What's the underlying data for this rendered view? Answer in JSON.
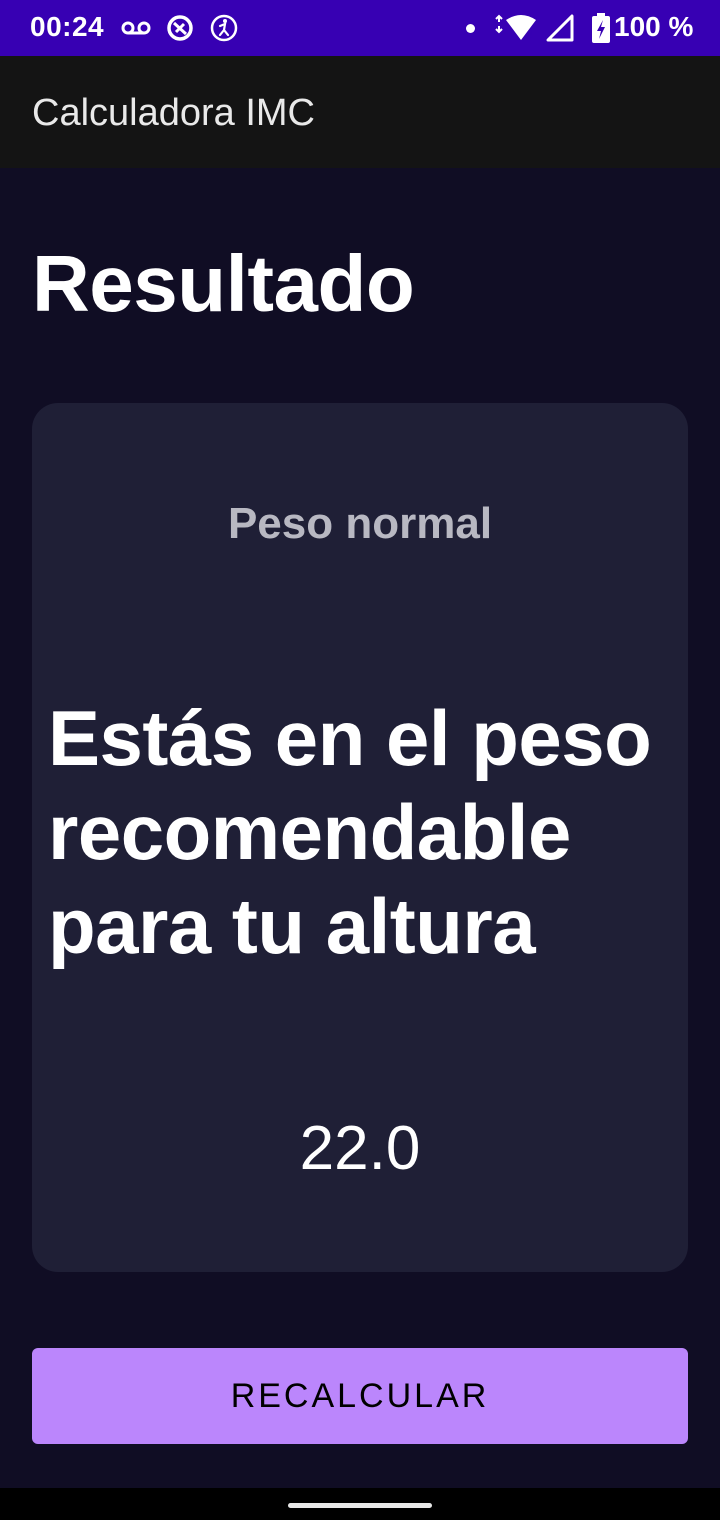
{
  "status_bar": {
    "time": "00:24",
    "battery_percent": "100 %",
    "icons": [
      "voicemail-icon",
      "data-saver-icon",
      "accessibility-icon",
      "notification-dot-icon",
      "wifi-icon",
      "signal-icon",
      "battery-charging-icon"
    ],
    "background_color": "#3700b3"
  },
  "app_bar": {
    "title": "Calculadora IMC",
    "background_color": "#141414"
  },
  "page": {
    "title": "Resultado",
    "background_color": "#100d24"
  },
  "result": {
    "category": "Peso normal",
    "description": "Estás en el peso recomendable para tu altura",
    "value": "22.0",
    "card_color": "#1f1f36"
  },
  "actions": {
    "recalculate_label": "RECALCULAR",
    "button_color": "#bb86fc"
  }
}
